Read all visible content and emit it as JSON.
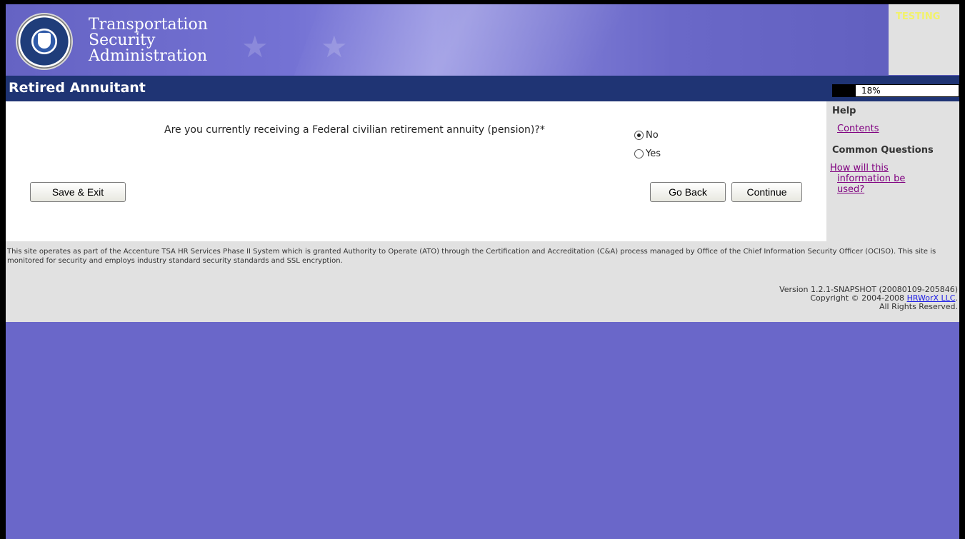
{
  "header": {
    "agency_name": [
      "Transportation",
      "Security",
      "Administration"
    ],
    "env_label": "TESTING"
  },
  "titlebar": {
    "title": "Retired Annuitant",
    "progress_label": "18%",
    "progress_value": 0.18
  },
  "form": {
    "question": "Are you currently receiving a Federal civilian retirement annuity (pension)?*",
    "options": [
      {
        "label": "No",
        "checked": true
      },
      {
        "label": "Yes",
        "checked": false
      }
    ],
    "save_exit_label": "Save & Exit",
    "go_back_label": "Go Back",
    "continue_label": "Continue"
  },
  "help": {
    "heading": "Help",
    "contents_link": "Contents",
    "common_questions_heading": "Common Questions",
    "question_link_lines": [
      "How will this",
      "information be",
      "used?"
    ]
  },
  "footer": {
    "notice": "This site operates as part of the Accenture TSA HR Services Phase II System which is granted Authority to Operate (ATO) through the Certification and Accreditation (C&A) process managed by Office of the Chief Information Security Officer (OCISO). This site is monitored for security and employs industry standard security standards and SSL encryption.",
    "version": "Version 1.2.1-SNAPSHOT (20080109-205846)",
    "copyright_prefix": "Copyright © 2004-2008 ",
    "company_link": "HRWorX LLC",
    "copyright_suffix": ".",
    "rights": "All Rights Reserved."
  },
  "colors": {
    "page_background": "#6a67c9",
    "title_bar": "#1f3474",
    "panel_gray": "#e1e1e1",
    "visited_link": "#800080",
    "link": "#1a1ae6",
    "testing_label": "#f2f26a"
  }
}
